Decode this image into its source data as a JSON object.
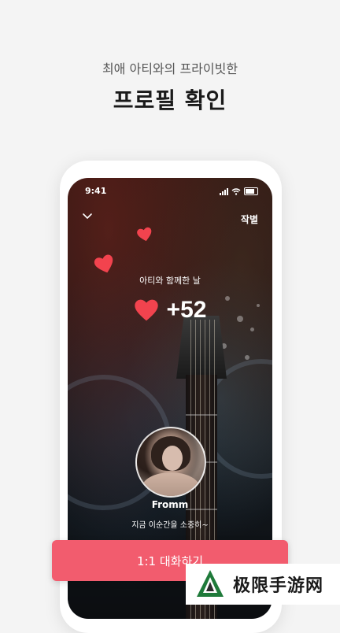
{
  "promo": {
    "subtitle": "최애 아티와의 프라이빗한",
    "headline": "프로필 확인"
  },
  "status_bar": {
    "time": "9:41"
  },
  "profile": {
    "farewell_label": "작별",
    "together_label": "아티와 함께한 날",
    "days_count": "+52",
    "artist_name": "Fromm",
    "artist_message": "지금 이순간을 소중히~"
  },
  "chat_button": {
    "label": "1:1 대화하기"
  },
  "watermark": {
    "text": "极限手游网"
  },
  "colors": {
    "accent": "#f25c6e",
    "heart": "#f2434e",
    "page_background": "#f4f4f4"
  }
}
